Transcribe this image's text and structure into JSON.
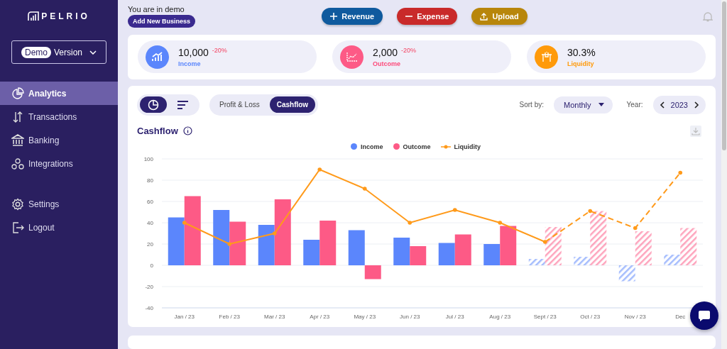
{
  "sidebar": {
    "logo": "PELRIO",
    "version": {
      "badge": "Demo",
      "label": "Version"
    },
    "items": [
      {
        "label": "Analytics",
        "selected": true
      },
      {
        "label": "Transactions",
        "selected": false
      },
      {
        "label": "Banking",
        "selected": false
      },
      {
        "label": "Integrations",
        "selected": false
      }
    ],
    "bottom_items": [
      {
        "label": "Settings"
      },
      {
        "label": "Logout"
      }
    ]
  },
  "topbar": {
    "notice": "You are in demo",
    "add_button": "Add New Business",
    "actions": [
      {
        "label": "Revenue",
        "kind": "revenue"
      },
      {
        "label": "Expense",
        "kind": "expense"
      },
      {
        "label": "Upload",
        "kind": "upload"
      }
    ]
  },
  "kpis": [
    {
      "value": "10,000",
      "change": "-20%",
      "label": "Income",
      "kind": "income"
    },
    {
      "value": "2,000",
      "change": "-20%",
      "label": "Outcome",
      "kind": "outcome"
    },
    {
      "value": "30.3%",
      "label": "Liquidity",
      "kind": "liquidity"
    }
  ],
  "cashflow": {
    "view_toggle": [
      {
        "kind": "pie",
        "selected": true
      },
      {
        "kind": "bars",
        "selected": false
      }
    ],
    "tabs": [
      {
        "label": "Profit & Loss",
        "selected": false
      },
      {
        "label": "Cashflow",
        "selected": true
      }
    ],
    "sort_label": "Sort by:",
    "sort_value": "Monthly",
    "year_label": "Year:",
    "year": "2023",
    "title": "Cashflow",
    "projected": [
      false,
      false,
      false,
      false,
      false,
      false,
      false,
      false,
      true,
      true,
      true,
      true
    ],
    "chart_data": {
      "type": "bar",
      "categories": [
        "Jan / 23",
        "Feb / 23",
        "Mar / 23",
        "Apr / 23",
        "May / 23",
        "Jun / 23",
        "Jul / 23",
        "Aug / 23",
        "Sept / 23",
        "Oct / 23",
        "Nov / 23",
        "Dec"
      ],
      "series": [
        {
          "name": "Income",
          "color": "#5b86fc",
          "values": [
            45,
            52,
            38,
            24,
            33,
            26,
            21,
            20,
            6,
            8,
            -15,
            10
          ]
        },
        {
          "name": "Outcome",
          "color": "#fd5a86",
          "values": [
            65,
            41,
            62,
            42,
            -13,
            18,
            29,
            37,
            36,
            51,
            32,
            35
          ]
        },
        {
          "name": "Liquidity",
          "type": "line",
          "color": "#ff9a1a",
          "values": [
            40,
            20,
            30,
            90,
            72,
            40,
            52,
            40,
            22,
            51,
            35,
            87
          ]
        }
      ],
      "grid": true,
      "legend": "top",
      "ylim": [
        -40,
        100
      ],
      "yticks": [
        -40,
        -20,
        0,
        20,
        40,
        60,
        80,
        100
      ]
    }
  }
}
